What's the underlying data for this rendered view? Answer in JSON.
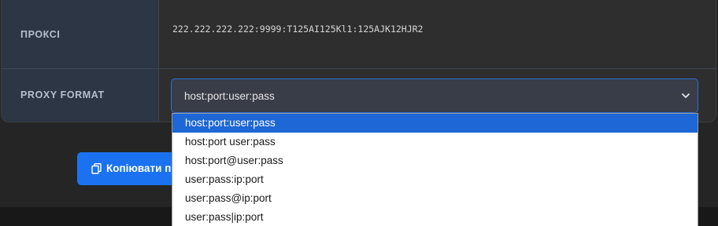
{
  "proxy_row": {
    "label": "ПРОКСІ",
    "value": "222.222.222.222:9999:T125AI125Kl1:125AJK12HJR2"
  },
  "format_row": {
    "label": "PROXY FORMAT",
    "selected_value": "host:port:user:pass",
    "options": [
      "host:port:user:pass",
      "host:port user:pass",
      "host:port@user:pass",
      "user:pass:ip:port",
      "user:pass@ip:port",
      "user:pass|ip:port"
    ]
  },
  "copy_button": {
    "label": "Копіювати п",
    "icon": "copy-icon"
  },
  "colors": {
    "accent": "#1b72f0",
    "selected_option": "#1d67d6"
  }
}
